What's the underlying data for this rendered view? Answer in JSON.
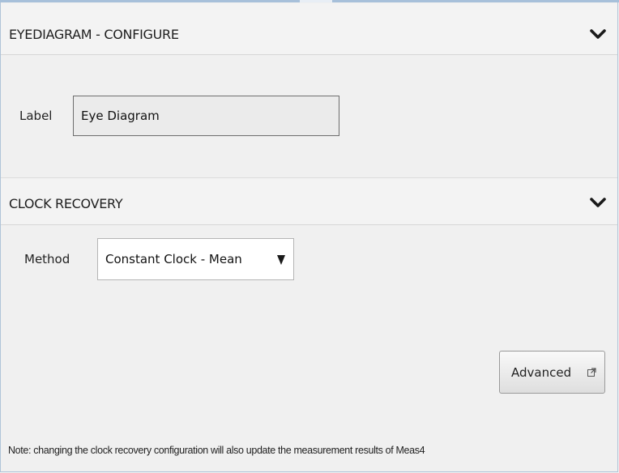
{
  "configure_section": {
    "title": "EYEDIAGRAM - CONFIGURE",
    "toggle_icon": "chevron-down-icon",
    "label_caption": "Label",
    "label_value": "Eye Diagram"
  },
  "clock_recovery_section": {
    "title": "CLOCK RECOVERY",
    "toggle_icon": "chevron-down-icon",
    "method_caption": "Method",
    "method_selected": "Constant Clock - Mean",
    "dropdown_icon": "triangle-down-icon",
    "advanced_label": "Advanced",
    "advanced_icon": "external-link-icon"
  },
  "footer": {
    "note": "Note: changing the clock recovery configuration will also update the measurement results of Meas4"
  },
  "colors": {
    "panel_border": "#b0c4d8",
    "background": "#f0f0f0"
  }
}
